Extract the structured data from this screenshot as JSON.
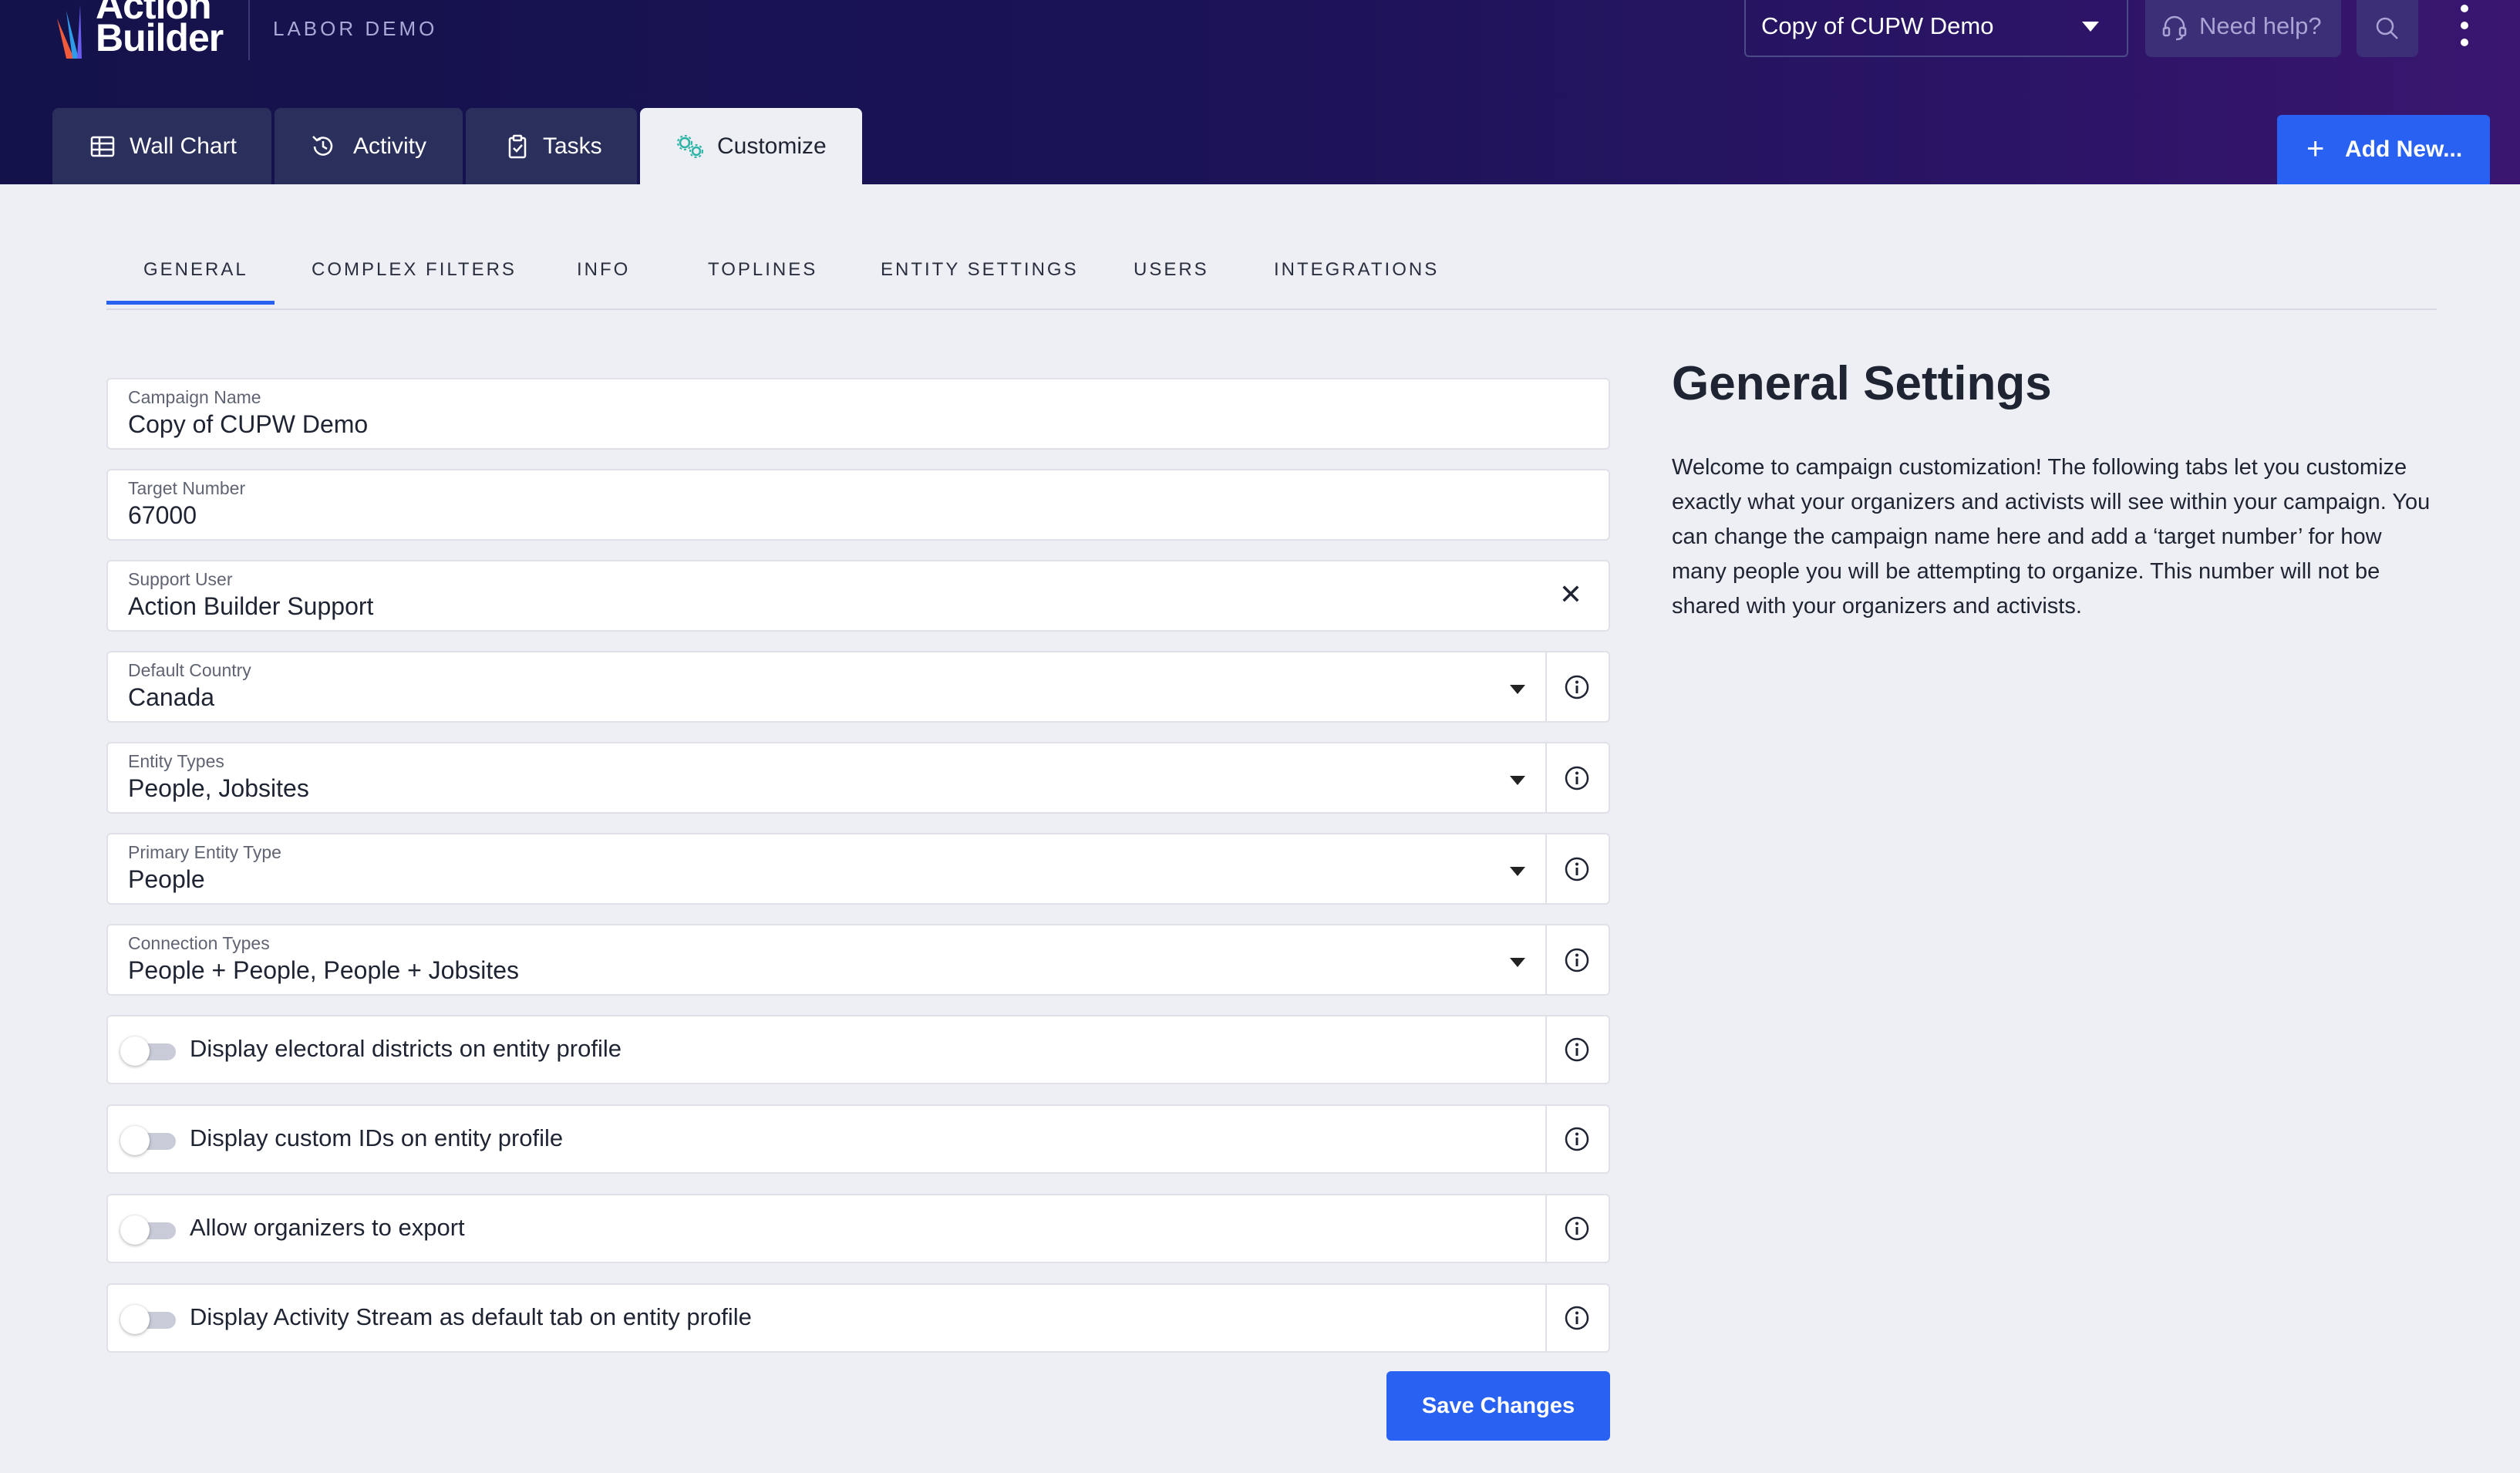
{
  "header": {
    "logo_line1": "Action",
    "logo_line2": "Builder",
    "org_name": "LABOR DEMO",
    "campaign_selected": "Copy of CUPW Demo",
    "help_label": "Need help?",
    "add_new_label": "Add New...",
    "tabs": [
      {
        "label": "Wall Chart",
        "icon": "table-icon"
      },
      {
        "label": "Activity",
        "icon": "history-icon"
      },
      {
        "label": "Tasks",
        "icon": "clipboard-icon"
      },
      {
        "label": "Customize",
        "icon": "gears-icon",
        "active": true
      }
    ]
  },
  "subtabs": [
    "GENERAL",
    "COMPLEX FILTERS",
    "INFO",
    "TOPLINES",
    "ENTITY SETTINGS",
    "USERS",
    "INTEGRATIONS"
  ],
  "form": {
    "campaign_name": {
      "label": "Campaign Name",
      "value": "Copy of CUPW Demo"
    },
    "target_number": {
      "label": "Target Number",
      "value": "67000"
    },
    "support_user": {
      "label": "Support User",
      "value": "Action Builder Support"
    },
    "default_country": {
      "label": "Default Country",
      "value": "Canada"
    },
    "entity_types": {
      "label": "Entity Types",
      "value": "People, Jobsites"
    },
    "primary_entity_type": {
      "label": "Primary Entity Type",
      "value": "People"
    },
    "connection_types": {
      "label": "Connection Types",
      "value": "People + People, People + Jobsites"
    },
    "toggles": [
      {
        "label": "Display electoral districts on entity profile",
        "on": false
      },
      {
        "label": "Display custom IDs on entity profile",
        "on": false
      },
      {
        "label": "Allow organizers to export",
        "on": false
      },
      {
        "label": "Display Activity Stream as default tab on entity profile",
        "on": false
      }
    ],
    "save_label": "Save Changes"
  },
  "panel": {
    "title": "General Settings",
    "description": "Welcome to campaign customization! The following tabs let you customize exactly what your organizers and activists will see within your campaign. You can change the campaign name here and add a ‘target number’ for how many people you will be attempting to organize. This number will not be shared with your organizers and activists."
  },
  "colors": {
    "accent": "#2962f2",
    "header_dark": "#14124a"
  }
}
